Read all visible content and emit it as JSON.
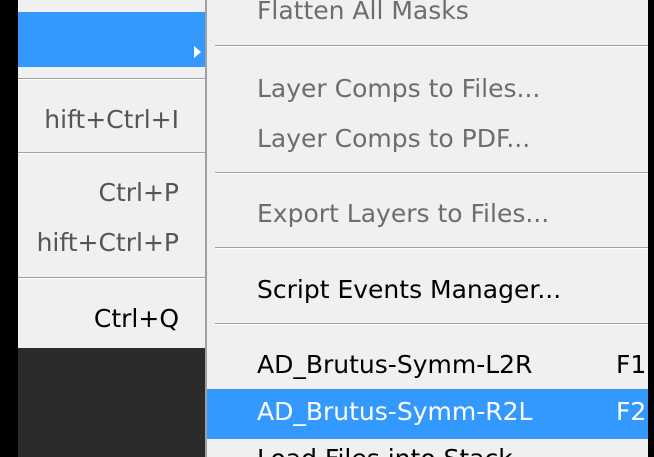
{
  "left_menu": {
    "shortcuts": [
      "hift+Ctrl+I",
      "Ctrl+P",
      "hift+Ctrl+P",
      "Ctrl+Q"
    ]
  },
  "submenu": {
    "items": [
      {
        "label": "Flatten All Masks",
        "enabled": false
      },
      {
        "label": "Layer Comps to Files...",
        "enabled": false
      },
      {
        "label": "Layer Comps to PDF...",
        "enabled": false
      },
      {
        "label": "Export Layers to Files...",
        "enabled": false
      },
      {
        "label": "Script Events Manager...",
        "enabled": true
      },
      {
        "label": "AD_Brutus-Symm-L2R",
        "shortcut": "F1",
        "enabled": true
      },
      {
        "label": "AD_Brutus-Symm-R2L",
        "shortcut": "F2",
        "enabled": true,
        "highlighted": true
      },
      {
        "label": "Load Files into Stack...",
        "enabled": true
      }
    ]
  },
  "colors": {
    "highlight": "#3399ff",
    "menu_bg": "#f0f0f0",
    "disabled_text": "#6d6d6d"
  }
}
